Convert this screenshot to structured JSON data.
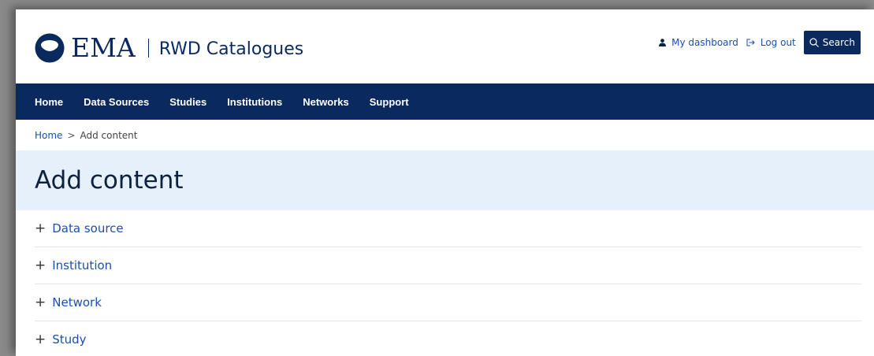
{
  "header": {
    "logo_text": "EMA",
    "site_name": "RWD Catalogues",
    "my_dashboard": "My dashboard",
    "log_out": "Log out",
    "search": "Search"
  },
  "nav": {
    "items": [
      "Home",
      "Data Sources",
      "Studies",
      "Institutions",
      "Networks",
      "Support"
    ]
  },
  "breadcrumb": {
    "home": "Home",
    "separator": ">",
    "current": "Add content"
  },
  "page_title": "Add content",
  "content_types": [
    "Data source",
    "Institution",
    "Network",
    "Study"
  ],
  "icons": {
    "plus": "+",
    "user": "user-icon",
    "logout": "logout-icon",
    "search": "search-icon"
  },
  "colors": {
    "brand_navy": "#0a2a5e",
    "link_blue": "#1a4fb0",
    "title_band": "#e6f0fb"
  }
}
